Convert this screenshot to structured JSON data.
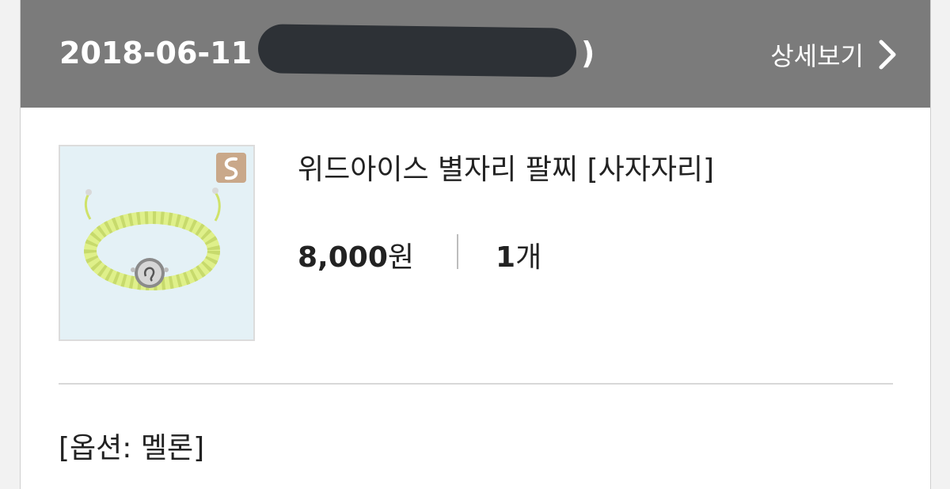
{
  "order": {
    "date": "2018-06-11",
    "paren_open": "(",
    "paren_close": ")",
    "detail_link_label": "상세보기",
    "detail_icon": "chevron-right-icon"
  },
  "product": {
    "name": "위드아이스 별자리 팔찌 [사자자리]",
    "price": "8,000",
    "price_unit": "원",
    "quantity": "1",
    "quantity_unit": "개",
    "image_subject": "lime-green macrame bracelet with silver Leo charm",
    "brand_badge_icon": "brand-badge-icon"
  },
  "option": {
    "text": "[옵션: 멜론]"
  },
  "colors": {
    "header_bg": "#7b7b7b",
    "redaction": "#2d3136",
    "thumb_bg": "#e4f1f6",
    "bracelet": "#dff08a"
  }
}
